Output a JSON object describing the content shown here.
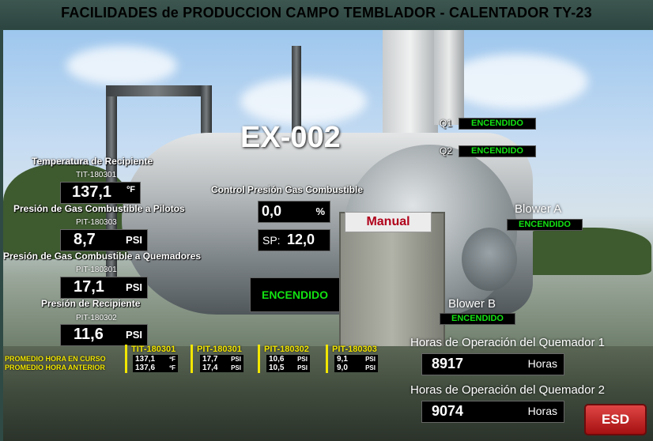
{
  "header": {
    "title": "FACILIDADES de PRODUCCION CAMPO TEMBLADOR - CALENTADOR TY-23"
  },
  "equipment": {
    "name": "EX-002"
  },
  "sensors": {
    "temp": {
      "label": "Temperatura de Recipiente",
      "tag": "TIT-180301",
      "value": "137,1",
      "unit": "ºF"
    },
    "pilot": {
      "label": "Presión de Gas Combustible a Pilotos",
      "tag": "PIT-180303",
      "value": "8,7",
      "unit": "PSI"
    },
    "burner": {
      "label": "Presión de Gas Combustible a Quemadores",
      "tag": "PIT-180301",
      "value": "17,1",
      "unit": "PSI"
    },
    "vessel": {
      "label": "Presión de Recipiente",
      "tag": "PIT-180302",
      "value": "11,6",
      "unit": "PSI"
    }
  },
  "control": {
    "label": "Control Presión Gas Combustible",
    "value": "0,0",
    "unit": "%",
    "sp_label": "SP:",
    "sp_value": "12,0",
    "mode": "Manual",
    "status": "ENCENDIDO"
  },
  "burners": [
    {
      "label": "Q1",
      "status": "ENCENDIDO"
    },
    {
      "label": "Q2",
      "status": "ENCENDIDO"
    }
  ],
  "blowers": [
    {
      "label": "Blower A",
      "status": "ENCENDIDO"
    },
    {
      "label": "Blower B",
      "status": "ENCENDIDO"
    }
  ],
  "averages": {
    "current_label": "PROMEDIO HORA EN CURSO",
    "previous_label": "PROMEDIO HORA ANTERIOR",
    "columns": [
      {
        "tag": "TIT-180301",
        "current": "137,1",
        "previous": "137,6",
        "unit": "ºF"
      },
      {
        "tag": "PIT-180301",
        "current": "17,7",
        "previous": "17,4",
        "unit": "PSI"
      },
      {
        "tag": "PIT-180302",
        "current": "10,6",
        "previous": "10,5",
        "unit": "PSI"
      },
      {
        "tag": "PIT-180303",
        "current": "9,1",
        "previous": "9,0",
        "unit": "PSI"
      }
    ]
  },
  "hours": [
    {
      "label": "Horas de Operación del Quemador 1",
      "value": "8917",
      "unit": "Horas"
    },
    {
      "label": "Horas de Operación del Quemador 2",
      "value": "9074",
      "unit": "Horas"
    }
  ],
  "esd": {
    "label": "ESD"
  }
}
